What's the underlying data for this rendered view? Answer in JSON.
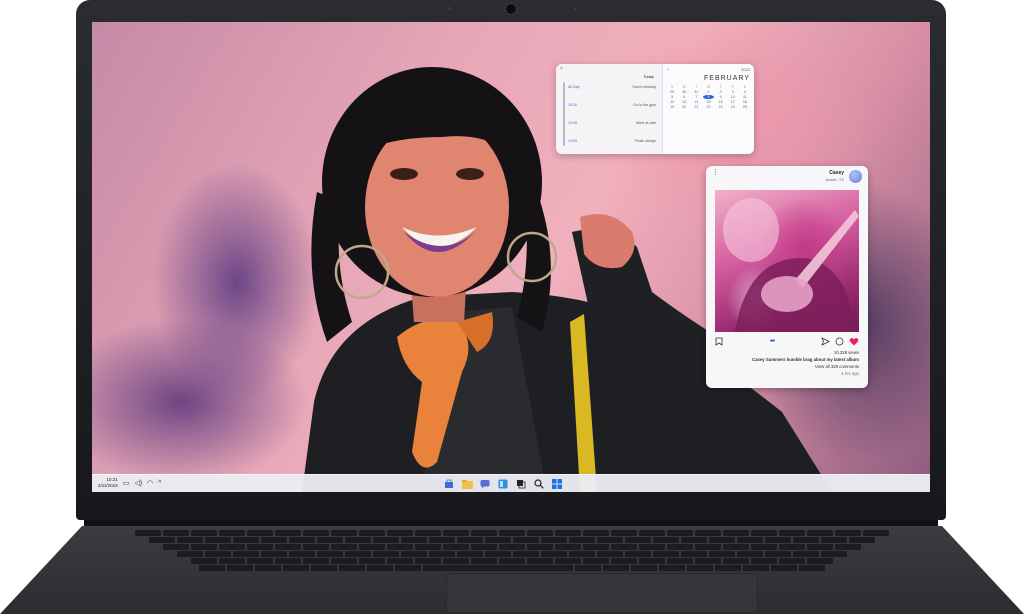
{
  "calendar_widget": {
    "close_glyph": "×",
    "today_label": "Today",
    "events": [
      {
        "time": "All Day",
        "title": "Sam's birthday"
      },
      {
        "time": "10:30",
        "title": "Go to the gym"
      },
      {
        "time": "12:00",
        "title": "Meet at cafe"
      },
      {
        "time": "14:00",
        "title": "Finish design"
      }
    ],
    "year_label": "2023",
    "add_glyph": "+",
    "month_title": "FEBRUARY",
    "weekday_headers": [
      "S",
      "M",
      "T",
      "W",
      "T",
      "F",
      "S"
    ],
    "days": [
      "29",
      "30",
      "31",
      "1",
      "2",
      "3",
      "4",
      "5",
      "6",
      "7",
      "8",
      "9",
      "10",
      "11",
      "12",
      "13",
      "14",
      "15",
      "16",
      "17",
      "18",
      "19",
      "20",
      "21",
      "22",
      "23",
      "24",
      "25"
    ],
    "selected_day": "8"
  },
  "post_widget": {
    "username": "Casey",
    "location": "Austin, TX",
    "views": "10,328 views",
    "caption": "Casey Summers humble brag about my latest album",
    "comments_link": "View all 328 comments",
    "age": "4 hrs ago"
  },
  "taskbar": {
    "clock_time": "10:21",
    "clock_date": "2/11/2023",
    "apps": [
      "start-icon",
      "search-icon",
      "task-view-icon",
      "widgets-icon",
      "chat-icon",
      "file-explorer-icon",
      "edge-icon",
      "store-icon"
    ]
  },
  "colors": {
    "accent": "#1f64d4",
    "heart": "#e0245e",
    "laptop_bezel": "#1f2024",
    "taskbar": "#ebebf2"
  }
}
